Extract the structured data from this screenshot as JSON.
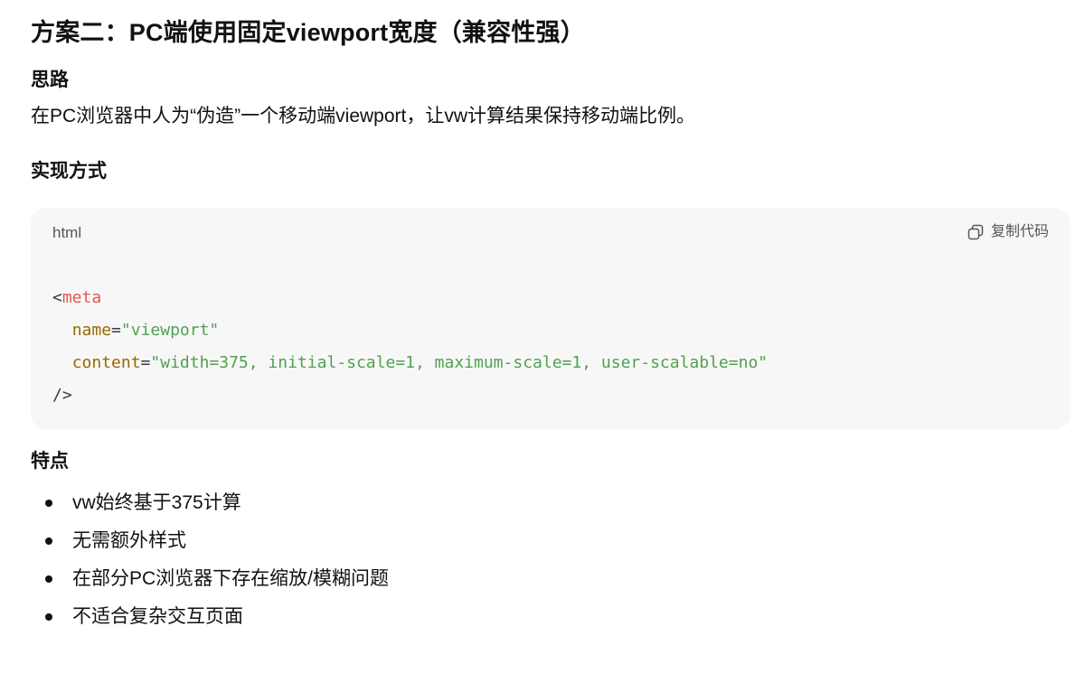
{
  "title": "方案二：PC端使用固定viewport宽度（兼容性强）",
  "idea": {
    "heading": "思路",
    "text": "在PC浏览器中人为“伪造”一个移动端viewport，让vw计算结果保持移动端比例。"
  },
  "implementation": {
    "heading": "实现方式",
    "code_block": {
      "language": "html",
      "copy_label": "复制代码",
      "copy_icon": "copy-icon",
      "lines": [
        [
          {
            "type": "punct",
            "text": "<"
          },
          {
            "type": "tag",
            "text": "meta"
          }
        ],
        [
          {
            "type": "plain",
            "text": "  "
          },
          {
            "type": "attr",
            "text": "name"
          },
          {
            "type": "punct",
            "text": "="
          },
          {
            "type": "str",
            "text": "\"viewport\""
          }
        ],
        [
          {
            "type": "plain",
            "text": "  "
          },
          {
            "type": "attr",
            "text": "content"
          },
          {
            "type": "punct",
            "text": "="
          },
          {
            "type": "str",
            "text": "\"width=375, initial-scale=1, maximum-scale=1, user-scalable=no\""
          }
        ],
        [
          {
            "type": "punct",
            "text": "/>"
          }
        ]
      ]
    }
  },
  "features": {
    "heading": "特点",
    "items": [
      "vw始终基于375计算",
      "无需额外样式",
      "在部分PC浏览器下存在缩放/模糊问题",
      "不适合复杂交互页面"
    ]
  },
  "colors": {
    "code_background": "#f7f7f8",
    "tag": "#e45649",
    "attribute": "#986801",
    "string": "#50a14f",
    "punctuation": "#383a42"
  }
}
